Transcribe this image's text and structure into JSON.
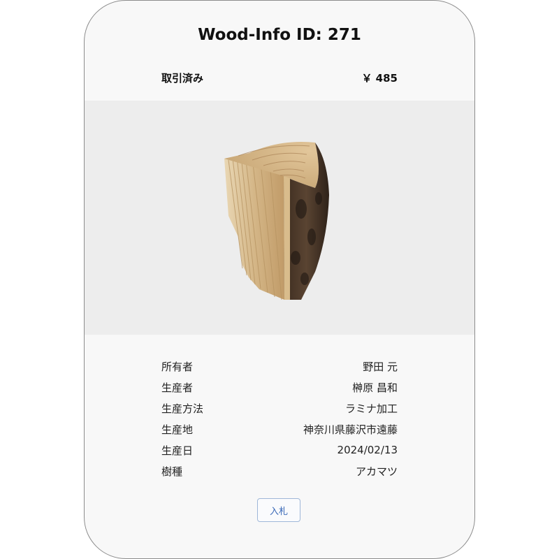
{
  "card": {
    "title": "Wood-Info ID: 271",
    "status": "取引済み",
    "price": "￥ 485"
  },
  "details": [
    {
      "label": "所有者",
      "value": "野田 元"
    },
    {
      "label": "生産者",
      "value": "榊原 昌和"
    },
    {
      "label": "生産方法",
      "value": "ラミナ加工"
    },
    {
      "label": "生産地",
      "value": "神奈川県藤沢市遠藤"
    },
    {
      "label": "生産日",
      "value": "2024/02/13"
    },
    {
      "label": "樹種",
      "value": "アカマツ"
    }
  ],
  "actions": {
    "bid_label": "入札"
  },
  "colors": {
    "card_bg": "#f8f8f8",
    "image_bg": "#ededed",
    "button_text": "#3a69b8",
    "button_border": "#9fb7d8"
  },
  "image": {
    "subject": "wood-sample-laminated-log-piece"
  }
}
